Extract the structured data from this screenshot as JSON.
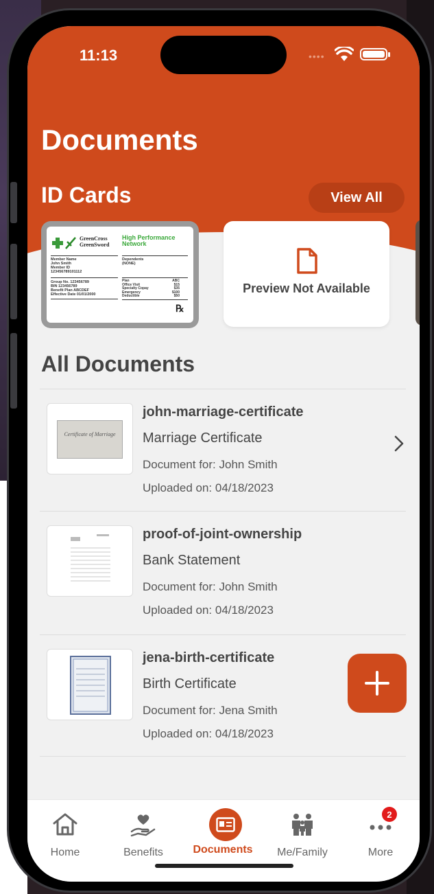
{
  "status_bar": {
    "time": "11:13",
    "dots": "••••"
  },
  "header": {
    "title": "Documents"
  },
  "id_cards": {
    "section_title": "ID Cards",
    "view_all_label": "View All",
    "card": {
      "brand_line1": "GreenCross",
      "brand_line2": "GreenSword",
      "network_line1": "High Performance",
      "network_line2": "Network",
      "member_label": "Member Name",
      "member_name": "John Smith",
      "member_id_label": "Member ID",
      "member_id": "123456789101112",
      "dependents_label": "Dependents",
      "dependents": "(NONE)",
      "group_line": "Group No. 123456789",
      "bin_line": "BIN 123456789",
      "benefit_line": "Benefit Plan ABCDEF",
      "effective_line": "Effective Date 01/01/2000",
      "plan_rows": [
        {
          "k": "Plan",
          "v": "ABC"
        },
        {
          "k": "Office Visit",
          "v": "$15"
        },
        {
          "k": "Specialty Copay",
          "v": "$35"
        },
        {
          "k": "Emergency",
          "v": "$100"
        },
        {
          "k": "Deductible",
          "v": "$50"
        }
      ],
      "rx": "℞"
    },
    "preview_text": "Preview Not Available"
  },
  "documents": {
    "section_title": "All Documents",
    "items": [
      {
        "name": "john-marriage-certificate",
        "type": "Marriage Certificate",
        "for": "Document for: John Smith",
        "uploaded": "Uploaded on: 04/18/2023",
        "thumb_text": "Certificate of Marriage"
      },
      {
        "name": "proof-of-joint-ownership",
        "type": "Bank Statement",
        "for": "Document for: John Smith",
        "uploaded": "Uploaded on: 04/18/2023",
        "thumb_text": ""
      },
      {
        "name": "jena-birth-certificate",
        "type": "Birth Certificate",
        "for": "Document for: Jena Smith",
        "uploaded": "Uploaded on: 04/18/2023",
        "thumb_text": ""
      }
    ]
  },
  "tabbar": {
    "items": [
      {
        "label": "Home",
        "icon": "home-icon"
      },
      {
        "label": "Benefits",
        "icon": "heart-hand-icon"
      },
      {
        "label": "Documents",
        "icon": "id-card-icon",
        "active": true
      },
      {
        "label": "Me/Family",
        "icon": "family-icon"
      },
      {
        "label": "More",
        "icon": "more-icon",
        "badge": "2"
      }
    ]
  },
  "colors": {
    "accent": "#cf4a1c",
    "background": "#f1f1f1",
    "badge": "#e21b1b"
  }
}
